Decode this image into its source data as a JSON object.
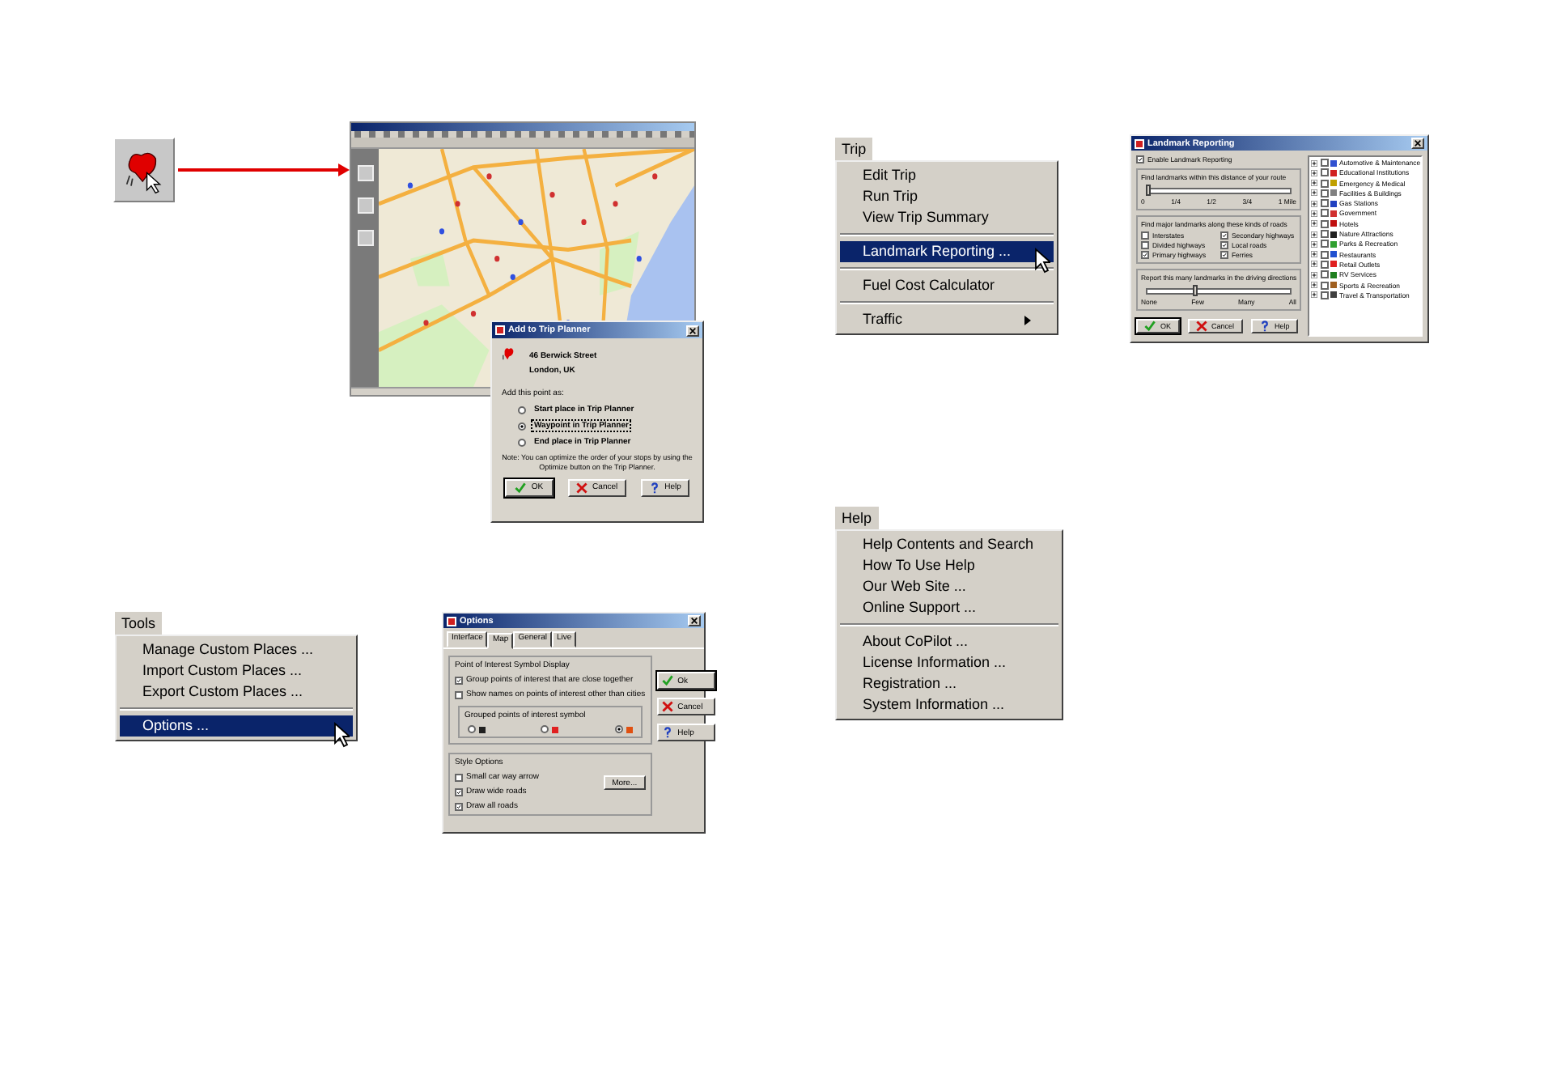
{
  "add_dialog": {
    "title": "Add to Trip Planner",
    "address": [
      "46 Berwick Street",
      "London, UK"
    ],
    "prompt": "Add this point as:",
    "options": [
      {
        "label": "Start place in Trip Planner",
        "selected": false
      },
      {
        "label": "Waypoint in Trip Planner",
        "selected": true
      },
      {
        "label": "End place in Trip Planner",
        "selected": false
      }
    ],
    "note": "Note: You can optimize the order of your stops by using the Optimize button on the Trip Planner.",
    "buttons": [
      "OK",
      "Cancel",
      "Help"
    ]
  },
  "tools_menu": {
    "title": "Tools",
    "items": [
      {
        "kind": "item",
        "label": "Manage Custom Places ...",
        "selected": false
      },
      {
        "kind": "item",
        "label": "Import Custom Places ...",
        "selected": false
      },
      {
        "kind": "item",
        "label": "Export Custom Places ...",
        "selected": false
      },
      {
        "kind": "separator"
      },
      {
        "kind": "item",
        "label": "Options ...",
        "selected": true
      }
    ]
  },
  "options_dialog": {
    "title": "Options",
    "tabs": [
      {
        "label": "Interface",
        "selected": false
      },
      {
        "label": "Map",
        "selected": true
      },
      {
        "label": "General",
        "selected": false
      },
      {
        "label": "Live",
        "selected": false
      }
    ],
    "poi_group": {
      "title": "Point of Interest Symbol Display",
      "checks": [
        {
          "label": "Group points of interest that are close together",
          "checked": true
        },
        {
          "label": "Show names on points of interest other than cities",
          "checked": false
        }
      ],
      "symbol_group": {
        "title": "Grouped points of interest symbol",
        "radios": [
          {
            "color": "#202020",
            "selected": false
          },
          {
            "color": "#e02020",
            "selected": false
          },
          {
            "color": "#e05010",
            "selected": true
          }
        ]
      }
    },
    "style_group": {
      "title": "Style Options",
      "checks": [
        {
          "label": "Small car way arrow",
          "checked": false
        },
        {
          "label": "Draw wide roads",
          "checked": true
        },
        {
          "label": "Draw all roads",
          "checked": true
        }
      ],
      "more_button": "More..."
    },
    "buttons": [
      "Ok",
      "Cancel",
      "Help"
    ]
  },
  "trip_menu": {
    "title": "Trip",
    "items": [
      {
        "kind": "item",
        "label": "Edit Trip",
        "selected": false
      },
      {
        "kind": "item",
        "label": "Run Trip",
        "selected": false
      },
      {
        "kind": "item",
        "label": "View Trip Summary",
        "selected": false
      },
      {
        "kind": "separator"
      },
      {
        "kind": "item",
        "label": "Landmark Reporting ...",
        "selected": true
      },
      {
        "kind": "separator"
      },
      {
        "kind": "item",
        "label": "Fuel Cost Calculator",
        "selected": false
      },
      {
        "kind": "separator"
      },
      {
        "kind": "submenu",
        "label": "Traffic",
        "selected": false
      }
    ]
  },
  "landmark_dialog": {
    "title": "Landmark Reporting",
    "enable": {
      "label": "Enable Landmark Reporting",
      "checked": true
    },
    "distance": {
      "title": "Find landmarks within this distance of your route",
      "level": 0,
      "ticks": [
        "0",
        "1/4",
        "1/2",
        "3/4",
        "1 Mile"
      ]
    },
    "roads": {
      "title": "Find major landmarks along these kinds of roads",
      "checks": [
        {
          "label": "Interstates",
          "checked": false
        },
        {
          "label": "Secondary highways",
          "checked": true
        },
        {
          "label": "Divided highways",
          "checked": false
        },
        {
          "label": "Local roads",
          "checked": true
        },
        {
          "label": "Primary highways",
          "checked": true
        },
        {
          "label": "Ferries",
          "checked": true
        }
      ]
    },
    "count": {
      "title": "Report this many landmarks in the driving directions",
      "level": 0.33,
      "ticks": [
        "None",
        "Few",
        "Many",
        "All"
      ]
    },
    "categories": [
      {
        "label": "Automotive & Maintenance",
        "checked": false,
        "color": "#3050d0"
      },
      {
        "label": "Educational Institutions",
        "checked": false,
        "color": "#d02020"
      },
      {
        "label": "Emergency & Medical",
        "checked": false,
        "color": "#c0a000"
      },
      {
        "label": "Facilities & Buildings",
        "checked": false,
        "color": "#808080"
      },
      {
        "label": "Gas Stations",
        "checked": false,
        "color": "#2040c0"
      },
      {
        "label": "Government",
        "checked": false,
        "color": "#d03030"
      },
      {
        "label": "Hotels",
        "checked": false,
        "color": "#c01010"
      },
      {
        "label": "Nature Attractions",
        "checked": false,
        "color": "#202020"
      },
      {
        "label": "Parks & Recreation",
        "checked": false,
        "color": "#30a030"
      },
      {
        "label": "Restaurants",
        "checked": false,
        "color": "#2050d0"
      },
      {
        "label": "Retail Outlets",
        "checked": false,
        "color": "#e02020"
      },
      {
        "label": "RV Services",
        "checked": false,
        "color": "#208020"
      },
      {
        "label": "Sports & Recreation",
        "checked": false,
        "color": "#a06020"
      },
      {
        "label": "Travel & Transportation",
        "checked": false,
        "color": "#404040"
      }
    ],
    "buttons": [
      "OK",
      "Cancel",
      "Help"
    ]
  },
  "help_menu": {
    "title": "Help",
    "items": [
      {
        "kind": "item",
        "label": "Help Contents and Search",
        "selected": false
      },
      {
        "kind": "item",
        "label": "How To Use Help",
        "selected": false
      },
      {
        "kind": "item",
        "label": "Our Web Site ...",
        "selected": false
      },
      {
        "kind": "item",
        "label": "Online Support ...",
        "selected": false
      },
      {
        "kind": "separator"
      },
      {
        "kind": "item",
        "label": "About CoPilot ...",
        "selected": false
      },
      {
        "kind": "item",
        "label": "License Information ...",
        "selected": false
      },
      {
        "kind": "item",
        "label": "Registration ...",
        "selected": false
      },
      {
        "kind": "item",
        "label": "System Information ...",
        "selected": false
      }
    ]
  }
}
